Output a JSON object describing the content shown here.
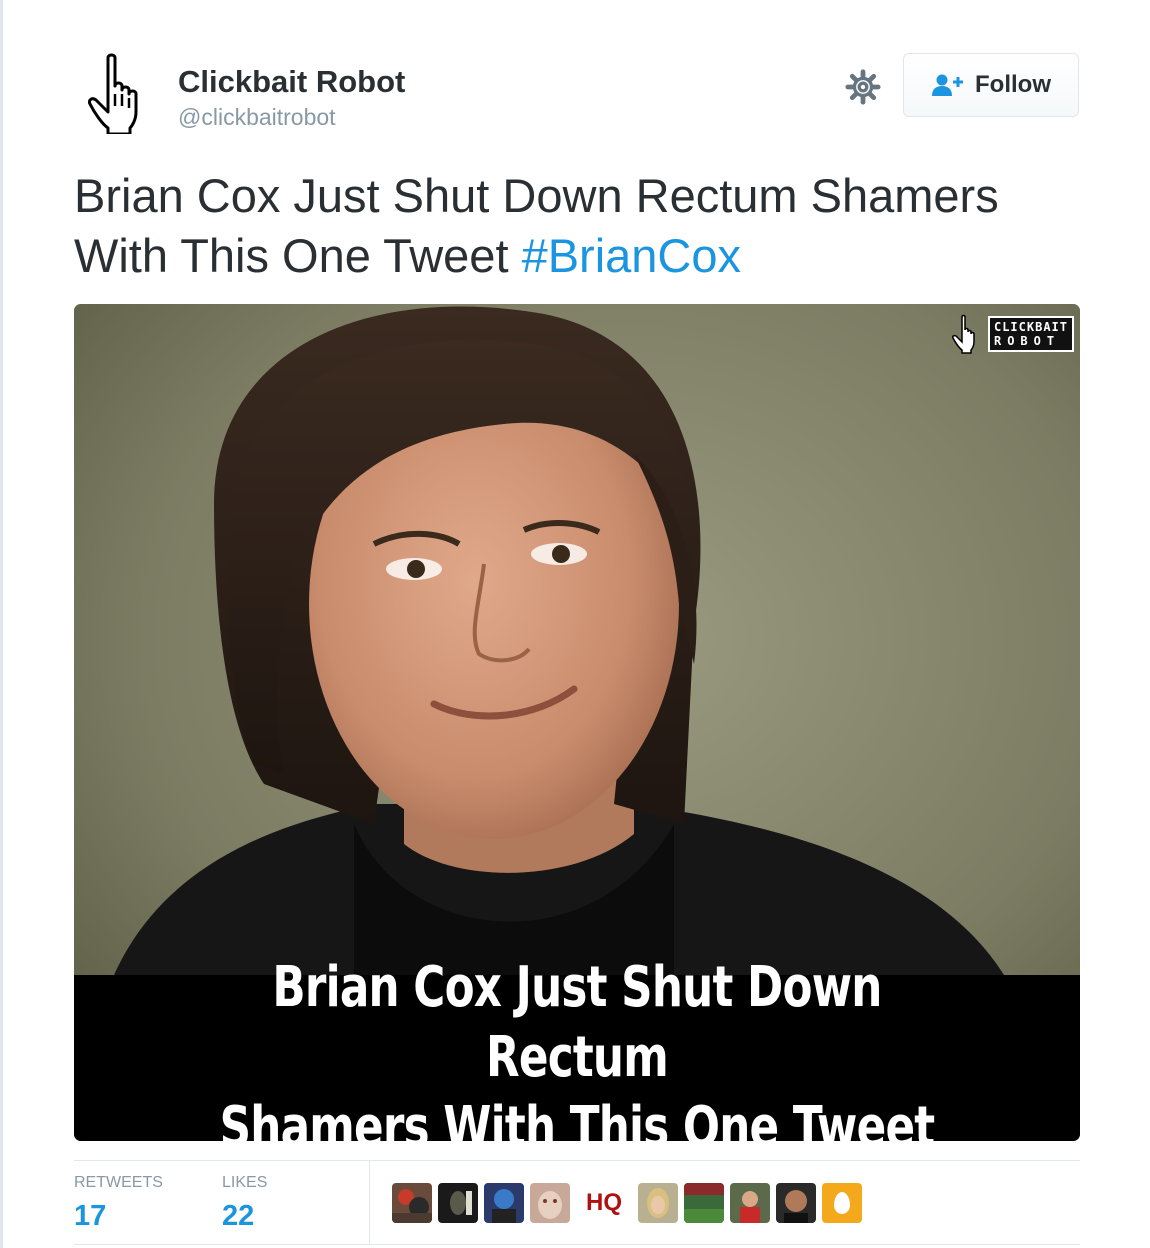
{
  "tweet": {
    "author": {
      "display_name": "Clickbait Robot",
      "handle": "@clickbaitrobot",
      "avatar_icon": "pointing-hand-cursor-icon"
    },
    "actions": {
      "settings_icon": "gear-icon",
      "follow_label": "Follow",
      "follow_icon": "add-person-icon"
    },
    "text": "Brian Cox Just Shut Down Rectum Shamers With This One Tweet ",
    "hashtag": "#BrianCox",
    "media": {
      "watermark_line1": "CLICKBAIT",
      "watermark_line2": "ROBOT",
      "caption_line1": "Brian Cox Just Shut Down Rectum",
      "caption_line2": "Shamers With This One Tweet"
    },
    "stats": {
      "retweets_label": "RETWEETS",
      "retweets_count": "17",
      "likes_label": "LIKES",
      "likes_count": "22",
      "liker_badge_text": "HQ"
    }
  },
  "colors": {
    "link_blue": "#1b95e0",
    "text_dark": "#292f33",
    "text_gray": "#8899a6",
    "border": "#e1e8ed"
  }
}
